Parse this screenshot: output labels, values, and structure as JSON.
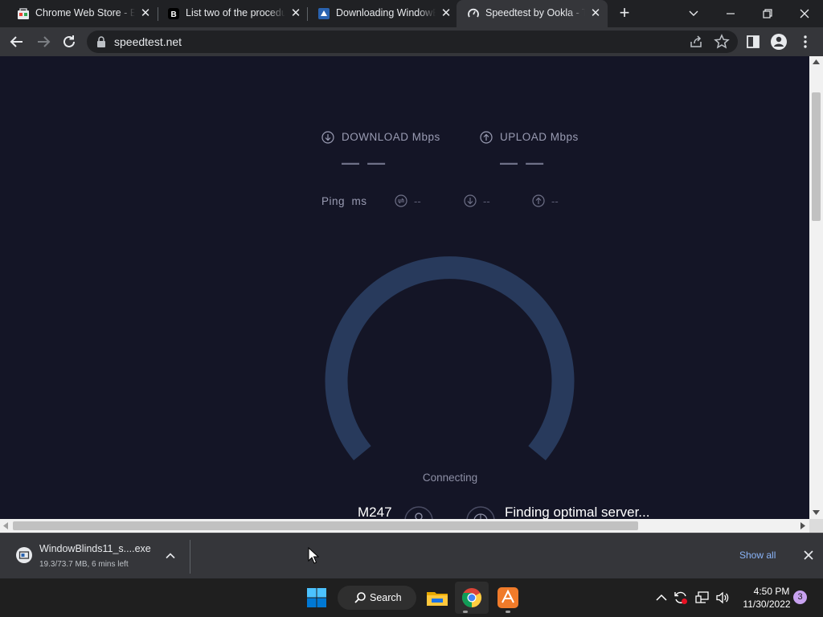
{
  "tabs": [
    {
      "title": "Chrome Web Store - Extensions",
      "active": false
    },
    {
      "title": "List two of the procedures",
      "active": false
    },
    {
      "title": "Downloading WindowBlinds",
      "active": false
    },
    {
      "title": "Speedtest by Ookla - The Global Broadband Speed Test",
      "active": true
    }
  ],
  "toolbar": {
    "url": "speedtest.net"
  },
  "speedtest": {
    "download_label": "DOWNLOAD",
    "download_unit": "Mbps",
    "upload_label": "UPLOAD",
    "upload_unit": "Mbps",
    "download_value": "— —",
    "upload_value": "— —",
    "ping_label": "Ping",
    "ping_unit": "ms",
    "jitter_value": "--",
    "ping_down_value": "--",
    "ping_up_value": "--",
    "status": "Connecting",
    "isp": "M247",
    "server_status": "Finding optimal server..."
  },
  "download": {
    "filename": "WindowBlinds11_s....exe",
    "status": "19.3/73.7 MB, 6 mins left",
    "show_all": "Show all"
  },
  "taskbar": {
    "search_label": "Search",
    "time": "4:50 PM",
    "date": "11/30/2022",
    "notification_count": "3"
  },
  "colors": {
    "page_bg": "#141526",
    "gauge": "#283a5c",
    "link": "#8ab4f8"
  }
}
